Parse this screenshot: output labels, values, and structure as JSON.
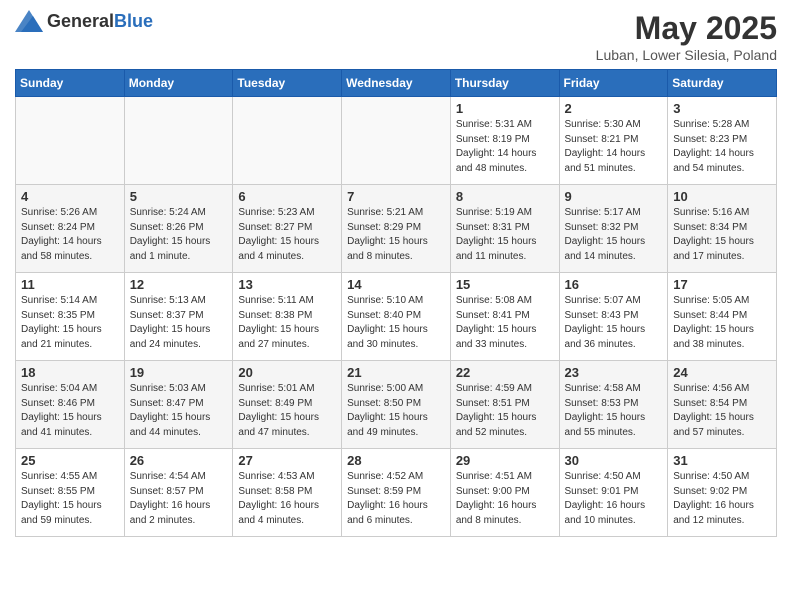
{
  "logo": {
    "general": "General",
    "blue": "Blue"
  },
  "header": {
    "month": "May 2025",
    "location": "Luban, Lower Silesia, Poland"
  },
  "days_of_week": [
    "Sunday",
    "Monday",
    "Tuesday",
    "Wednesday",
    "Thursday",
    "Friday",
    "Saturday"
  ],
  "weeks": [
    [
      {
        "day": "",
        "info": ""
      },
      {
        "day": "",
        "info": ""
      },
      {
        "day": "",
        "info": ""
      },
      {
        "day": "",
        "info": ""
      },
      {
        "day": "1",
        "info": "Sunrise: 5:31 AM\nSunset: 8:19 PM\nDaylight: 14 hours\nand 48 minutes."
      },
      {
        "day": "2",
        "info": "Sunrise: 5:30 AM\nSunset: 8:21 PM\nDaylight: 14 hours\nand 51 minutes."
      },
      {
        "day": "3",
        "info": "Sunrise: 5:28 AM\nSunset: 8:23 PM\nDaylight: 14 hours\nand 54 minutes."
      }
    ],
    [
      {
        "day": "4",
        "info": "Sunrise: 5:26 AM\nSunset: 8:24 PM\nDaylight: 14 hours\nand 58 minutes."
      },
      {
        "day": "5",
        "info": "Sunrise: 5:24 AM\nSunset: 8:26 PM\nDaylight: 15 hours\nand 1 minute."
      },
      {
        "day": "6",
        "info": "Sunrise: 5:23 AM\nSunset: 8:27 PM\nDaylight: 15 hours\nand 4 minutes."
      },
      {
        "day": "7",
        "info": "Sunrise: 5:21 AM\nSunset: 8:29 PM\nDaylight: 15 hours\nand 8 minutes."
      },
      {
        "day": "8",
        "info": "Sunrise: 5:19 AM\nSunset: 8:31 PM\nDaylight: 15 hours\nand 11 minutes."
      },
      {
        "day": "9",
        "info": "Sunrise: 5:17 AM\nSunset: 8:32 PM\nDaylight: 15 hours\nand 14 minutes."
      },
      {
        "day": "10",
        "info": "Sunrise: 5:16 AM\nSunset: 8:34 PM\nDaylight: 15 hours\nand 17 minutes."
      }
    ],
    [
      {
        "day": "11",
        "info": "Sunrise: 5:14 AM\nSunset: 8:35 PM\nDaylight: 15 hours\nand 21 minutes."
      },
      {
        "day": "12",
        "info": "Sunrise: 5:13 AM\nSunset: 8:37 PM\nDaylight: 15 hours\nand 24 minutes."
      },
      {
        "day": "13",
        "info": "Sunrise: 5:11 AM\nSunset: 8:38 PM\nDaylight: 15 hours\nand 27 minutes."
      },
      {
        "day": "14",
        "info": "Sunrise: 5:10 AM\nSunset: 8:40 PM\nDaylight: 15 hours\nand 30 minutes."
      },
      {
        "day": "15",
        "info": "Sunrise: 5:08 AM\nSunset: 8:41 PM\nDaylight: 15 hours\nand 33 minutes."
      },
      {
        "day": "16",
        "info": "Sunrise: 5:07 AM\nSunset: 8:43 PM\nDaylight: 15 hours\nand 36 minutes."
      },
      {
        "day": "17",
        "info": "Sunrise: 5:05 AM\nSunset: 8:44 PM\nDaylight: 15 hours\nand 38 minutes."
      }
    ],
    [
      {
        "day": "18",
        "info": "Sunrise: 5:04 AM\nSunset: 8:46 PM\nDaylight: 15 hours\nand 41 minutes."
      },
      {
        "day": "19",
        "info": "Sunrise: 5:03 AM\nSunset: 8:47 PM\nDaylight: 15 hours\nand 44 minutes."
      },
      {
        "day": "20",
        "info": "Sunrise: 5:01 AM\nSunset: 8:49 PM\nDaylight: 15 hours\nand 47 minutes."
      },
      {
        "day": "21",
        "info": "Sunrise: 5:00 AM\nSunset: 8:50 PM\nDaylight: 15 hours\nand 49 minutes."
      },
      {
        "day": "22",
        "info": "Sunrise: 4:59 AM\nSunset: 8:51 PM\nDaylight: 15 hours\nand 52 minutes."
      },
      {
        "day": "23",
        "info": "Sunrise: 4:58 AM\nSunset: 8:53 PM\nDaylight: 15 hours\nand 55 minutes."
      },
      {
        "day": "24",
        "info": "Sunrise: 4:56 AM\nSunset: 8:54 PM\nDaylight: 15 hours\nand 57 minutes."
      }
    ],
    [
      {
        "day": "25",
        "info": "Sunrise: 4:55 AM\nSunset: 8:55 PM\nDaylight: 15 hours\nand 59 minutes."
      },
      {
        "day": "26",
        "info": "Sunrise: 4:54 AM\nSunset: 8:57 PM\nDaylight: 16 hours\nand 2 minutes."
      },
      {
        "day": "27",
        "info": "Sunrise: 4:53 AM\nSunset: 8:58 PM\nDaylight: 16 hours\nand 4 minutes."
      },
      {
        "day": "28",
        "info": "Sunrise: 4:52 AM\nSunset: 8:59 PM\nDaylight: 16 hours\nand 6 minutes."
      },
      {
        "day": "29",
        "info": "Sunrise: 4:51 AM\nSunset: 9:00 PM\nDaylight: 16 hours\nand 8 minutes."
      },
      {
        "day": "30",
        "info": "Sunrise: 4:50 AM\nSunset: 9:01 PM\nDaylight: 16 hours\nand 10 minutes."
      },
      {
        "day": "31",
        "info": "Sunrise: 4:50 AM\nSunset: 9:02 PM\nDaylight: 16 hours\nand 12 minutes."
      }
    ]
  ]
}
